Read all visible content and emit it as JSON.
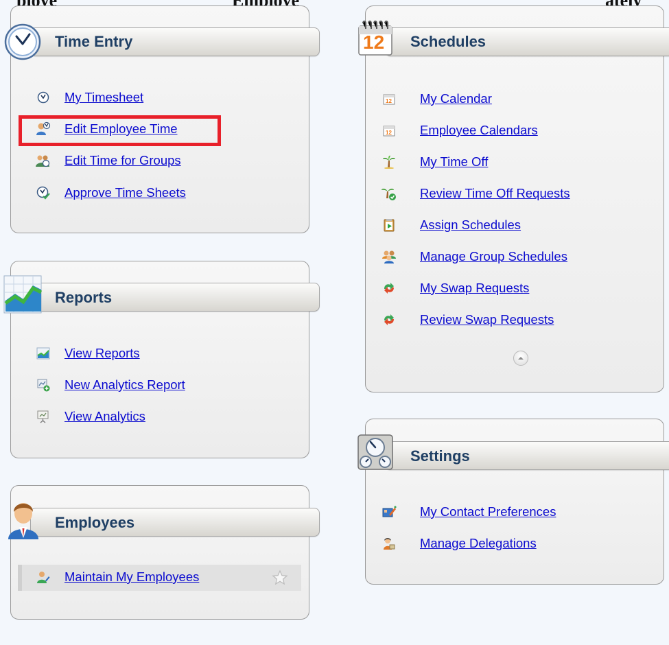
{
  "top_banner": {
    "left": "ploye",
    "middle": "Employe",
    "right": "ately"
  },
  "colors": {
    "link": "#0b0bcf",
    "panel_title": "#1f3f64",
    "highlight": "#e8202a"
  },
  "time_entry": {
    "title": "Time Entry",
    "header_icon": "clock-icon",
    "items": [
      {
        "label": "My Timesheet",
        "icon": "clock-icon"
      },
      {
        "label": "Edit Employee Time",
        "icon": "user-clock-icon"
      },
      {
        "label": "Edit Time for Groups",
        "icon": "group-clock-icon"
      },
      {
        "label": "Approve Time Sheets",
        "icon": "clock-check-icon"
      }
    ]
  },
  "reports": {
    "title": "Reports",
    "header_icon": "chart-icon",
    "items": [
      {
        "label": "View Reports",
        "icon": "chart-icon"
      },
      {
        "label": "New Analytics Report",
        "icon": "add-report-icon"
      },
      {
        "label": "View Analytics",
        "icon": "presentation-icon"
      }
    ]
  },
  "employees": {
    "title": "Employees",
    "header_icon": "employee-avatar-icon",
    "items": [
      {
        "label": "Maintain My Employees",
        "icon": "user-edit-icon",
        "favorite_icon": "star-icon"
      }
    ]
  },
  "schedules": {
    "title": "Schedules",
    "header_icon": "calendar-icon",
    "header_icon_text": "12",
    "items": [
      {
        "label": "My Calendar",
        "icon": "calendar-icon"
      },
      {
        "label": "Employee Calendars",
        "icon": "calendar-icon"
      },
      {
        "label": "My Time Off",
        "icon": "palm-tree-icon"
      },
      {
        "label": "Review Time Off Requests",
        "icon": "palm-tree-check-icon"
      },
      {
        "label": "Assign Schedules",
        "icon": "clipboard-play-icon"
      },
      {
        "label": "Manage Group Schedules",
        "icon": "group-icon"
      },
      {
        "label": "My Swap Requests",
        "icon": "swap-arrows-icon"
      },
      {
        "label": "Review Swap Requests",
        "icon": "swap-arrows-icon"
      }
    ],
    "collapse_icon": "chevron-up-icon"
  },
  "settings": {
    "title": "Settings",
    "header_icon": "gauges-icon",
    "items": [
      {
        "label": "My Contact Preferences",
        "icon": "contact-edit-icon"
      },
      {
        "label": "Manage Delegations",
        "icon": "delegation-icon"
      }
    ]
  }
}
